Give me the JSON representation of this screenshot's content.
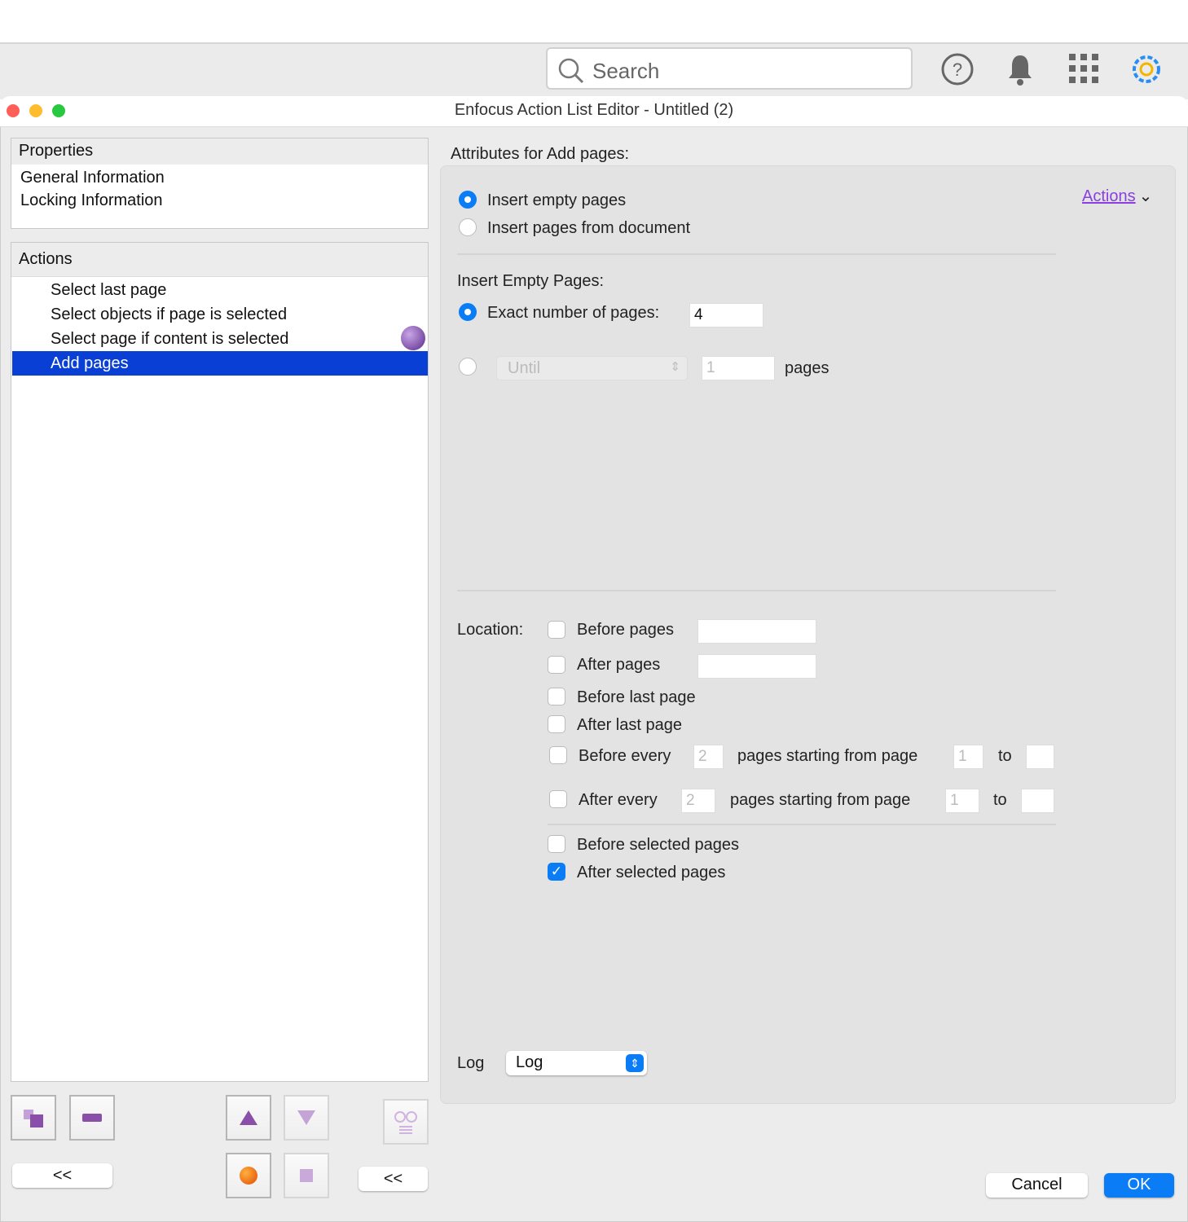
{
  "topbar": {
    "search_placeholder": "Search"
  },
  "window": {
    "title": "Enfocus Action List Editor - Untitled (2)"
  },
  "properties": {
    "header": "Properties",
    "items": [
      "General Information",
      "Locking Information"
    ]
  },
  "actions": {
    "header": "Actions",
    "items": [
      "Select last page",
      "Select objects if page is selected",
      "Select page if content is selected",
      "Add pages"
    ],
    "selected": 3
  },
  "attributes": {
    "title": "Attributes for Add pages:",
    "actions_link": "Actions",
    "mode": [
      "Insert empty pages",
      "Insert pages from document"
    ],
    "empty_title": "Insert Empty Pages:",
    "exact_label": "Exact number of pages:",
    "exact_value": "4",
    "until_select": "Until",
    "until_value": "1",
    "pages_label": "pages",
    "location_label": "Location:",
    "before_pages": "Before pages",
    "after_pages": "After pages",
    "before_last": "Before last page",
    "after_last": "After last page",
    "before_every": "Before every",
    "before_every_val": "2",
    "after_every": "After every",
    "after_every_val": "2",
    "starting_from": "pages starting from page",
    "start_val": "1",
    "to": "to",
    "before_selected": "Before selected pages",
    "after_selected": "After selected pages",
    "log_label": "Log",
    "log_value": "Log"
  },
  "footer": {
    "collapse_left": "<<",
    "collapse_right": "<<",
    "cancel": "Cancel",
    "ok": "OK"
  },
  "colors": {
    "accent": "#0a7cf5",
    "selection": "#0a3fd6",
    "icon_purple": "#8a4fa8"
  }
}
